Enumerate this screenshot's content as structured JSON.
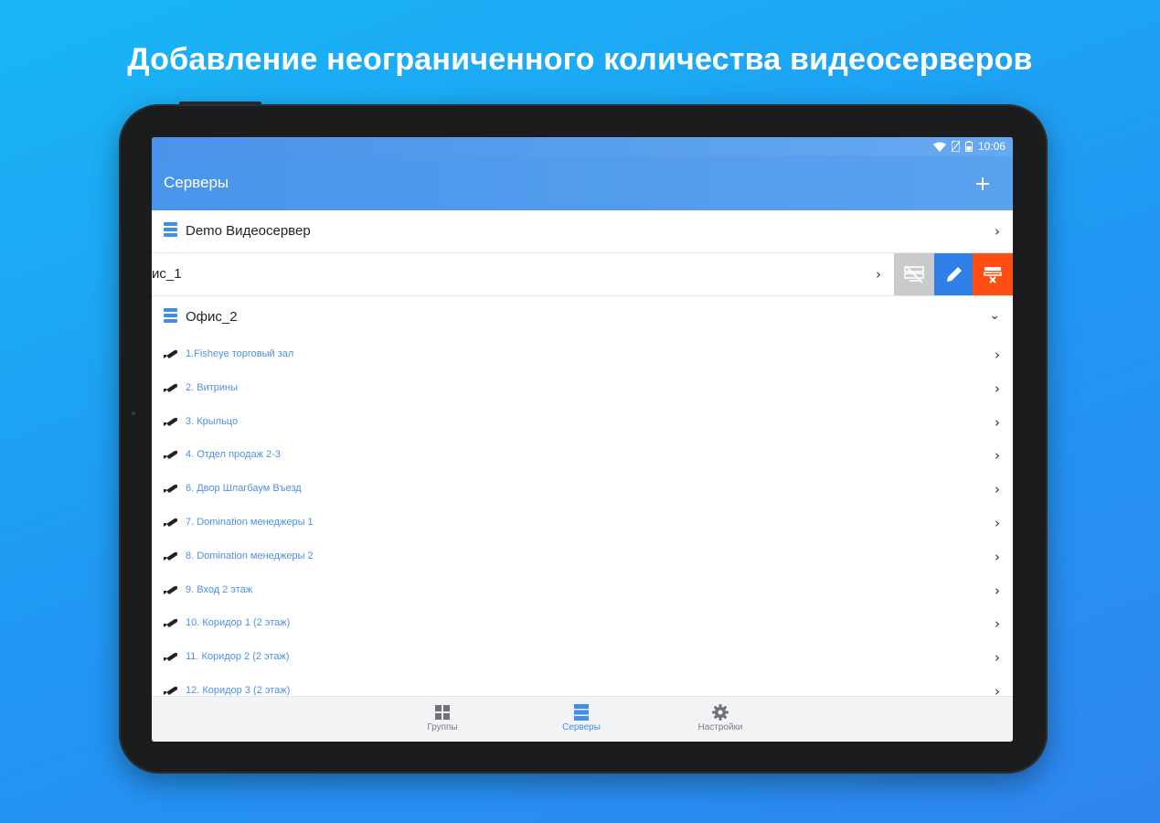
{
  "headline": "Добавление неограниченного количества видеосерверов",
  "status_bar": {
    "time": "10:06"
  },
  "app_bar": {
    "title": "Серверы",
    "add_icon": "plus-icon"
  },
  "servers": [
    {
      "label": "Demo Видеосервер",
      "state": "collapsed"
    },
    {
      "label": "ис_1",
      "state": "swiped",
      "actions": [
        "disable-server-icon",
        "edit-icon",
        "delete-server-icon"
      ]
    },
    {
      "label": "Офис_2",
      "state": "expanded"
    }
  ],
  "cameras": [
    "1.Fisheye торговый зал",
    "2. Витрины",
    "3. Крыльцо",
    "4. Отдел продаж 2-3",
    "6. Двор Шлагбаум Въезд",
    "7. Domination менеджеры 1",
    "8. Domination менеджеры 2",
    "9. Вход 2 этаж",
    "10. Коридор 1 (2 этаж)",
    "11. Коридор 2 (2 этаж)",
    "12. Коридор 3 (2 этаж)"
  ],
  "bottom_nav": [
    {
      "label": "Группы",
      "icon": "grid-icon",
      "active": false
    },
    {
      "label": "Серверы",
      "icon": "servers-icon",
      "active": true
    },
    {
      "label": "Настройки",
      "icon": "gear-icon",
      "active": false
    }
  ],
  "colors": {
    "accent": "#3f8ee8",
    "swipe_disable": "#c9cacc",
    "swipe_edit": "#2f7fe6",
    "swipe_delete": "#ff4d14",
    "camera_text": "#4f8fe3"
  }
}
